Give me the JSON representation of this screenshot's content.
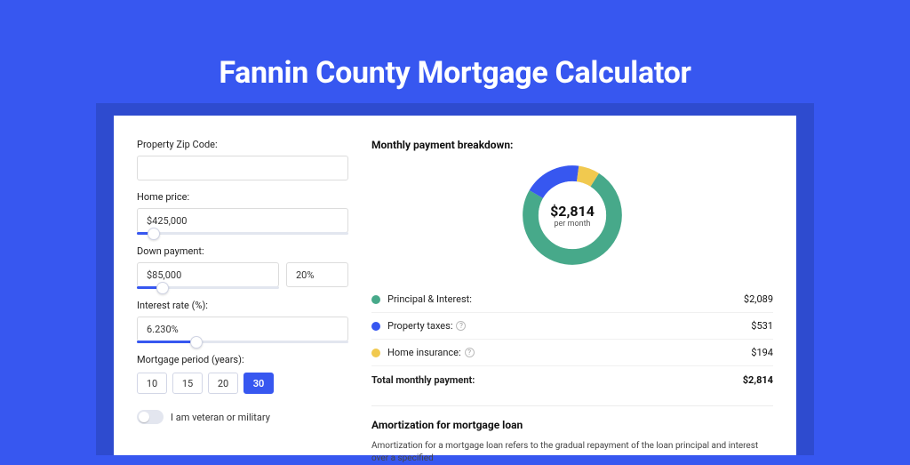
{
  "page_title": "Fannin County Mortgage Calculator",
  "form": {
    "zip_label": "Property Zip Code:",
    "zip_value": "",
    "home_price_label": "Home price:",
    "home_price_value": "$425,000",
    "home_price_slider_pct": 8,
    "down_payment_label": "Down payment:",
    "down_payment_value": "$85,000",
    "down_payment_pct_value": "20%",
    "down_payment_slider_pct": 18,
    "interest_label": "Interest rate (%):",
    "interest_value": "6.230%",
    "interest_slider_pct": 28,
    "period_label": "Mortgage period (years):",
    "period_options": [
      "10",
      "15",
      "20",
      "30"
    ],
    "period_selected": "30",
    "veteran_label": "I am veteran or military",
    "veteran_on": false
  },
  "breakdown": {
    "heading": "Monthly payment breakdown:",
    "center_value": "$2,814",
    "center_sub": "per month",
    "items": [
      {
        "label": "Principal & Interest:",
        "amount": "$2,089",
        "color": "#47a98a",
        "help": false
      },
      {
        "label": "Property taxes:",
        "amount": "$531",
        "color": "#3757f0",
        "help": true
      },
      {
        "label": "Home insurance:",
        "amount": "$194",
        "color": "#f1c94f",
        "help": true
      }
    ],
    "total_label": "Total monthly payment:",
    "total_amount": "$2,814"
  },
  "amort": {
    "heading": "Amortization for mortgage loan",
    "text": "Amortization for a mortgage loan refers to the gradual repayment of the loan principal and interest over a specified"
  },
  "chart_data": {
    "type": "pie",
    "title": "Monthly payment breakdown",
    "series": [
      {
        "name": "Principal & Interest",
        "value": 2089,
        "color": "#47a98a"
      },
      {
        "name": "Property taxes",
        "value": 531,
        "color": "#3757f0"
      },
      {
        "name": "Home insurance",
        "value": 194,
        "color": "#f1c94f"
      }
    ],
    "total": 2814,
    "center_label": "$2,814 per month"
  }
}
